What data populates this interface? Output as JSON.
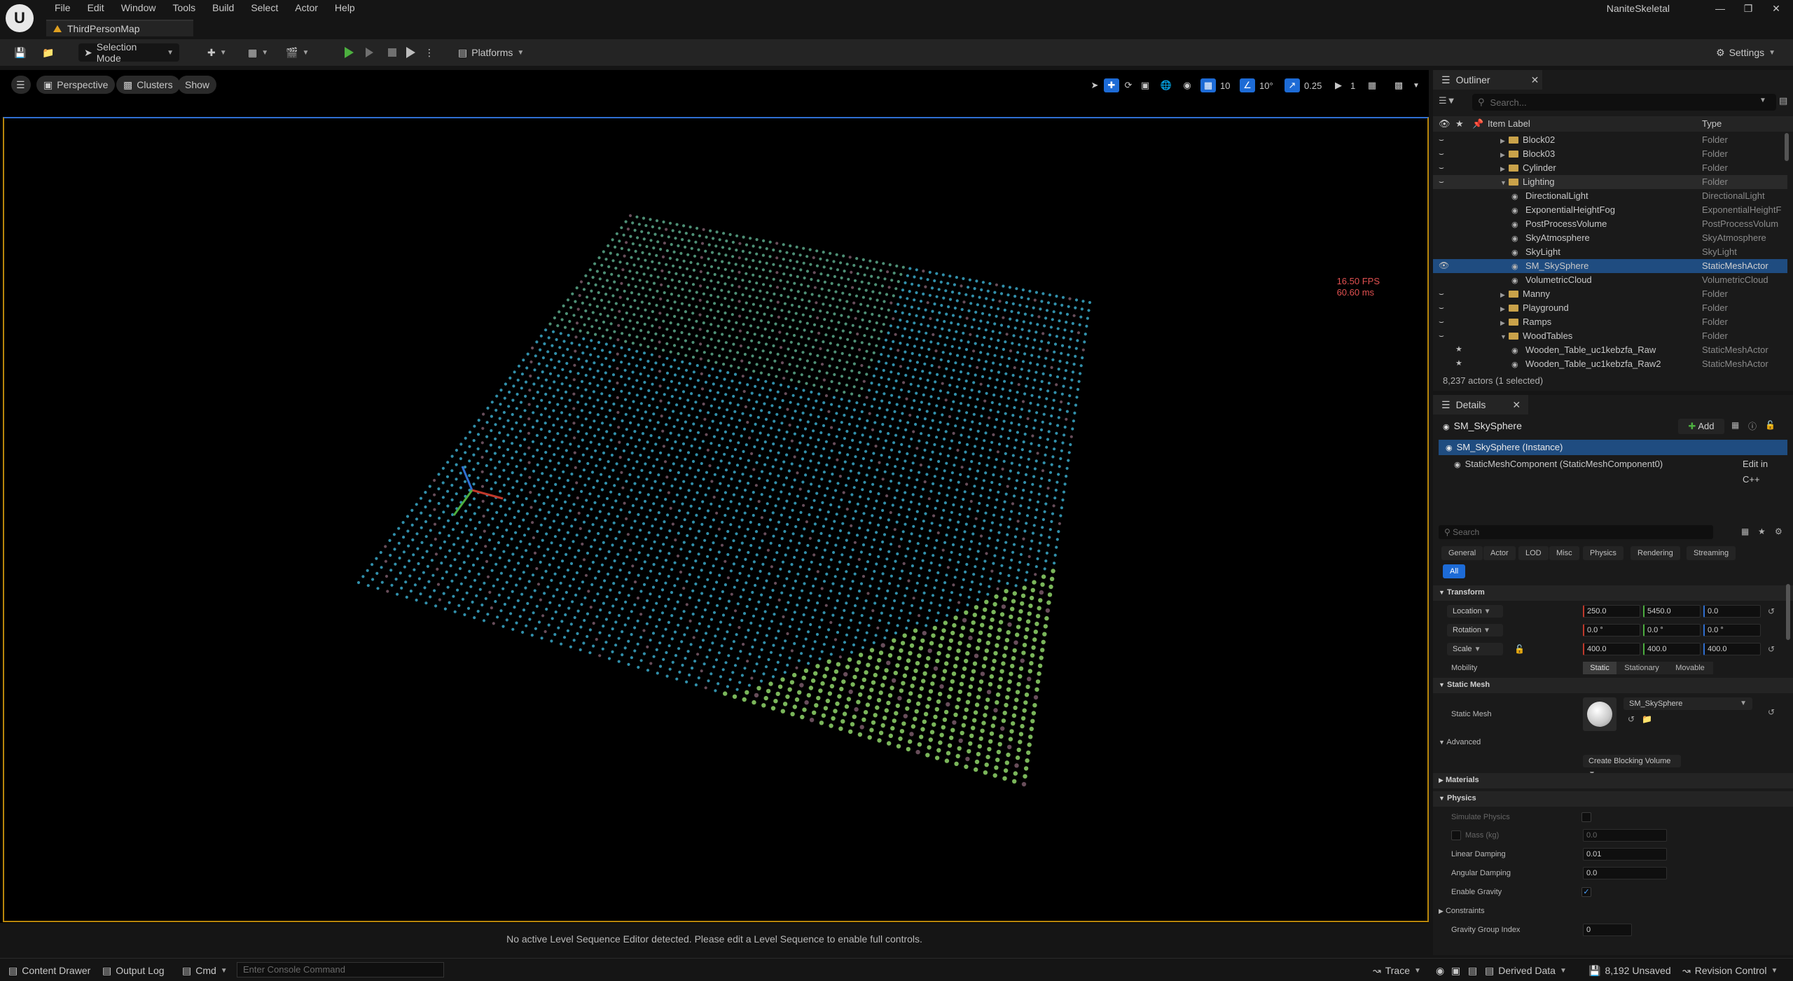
{
  "app": {
    "menu": [
      "File",
      "Edit",
      "Window",
      "Tools",
      "Build",
      "Select",
      "Actor",
      "Help"
    ],
    "map_tab": "ThirdPersonMap",
    "project_name": "NaniteSkeletal",
    "logo_letter": "U"
  },
  "toolbar": {
    "selection_mode": "Selection Mode",
    "platforms": "Platforms",
    "settings": "Settings"
  },
  "viewport": {
    "view_mode": "Perspective",
    "show_flag": "Clusters",
    "show": "Show",
    "grid_size": "10",
    "rotation_snap": "10°",
    "scale_snap": "0.25",
    "camera_speed": "1",
    "fps": "16.50 FPS",
    "frame_ms": "60.60 ms",
    "sequencer_message": "No active Level Sequence Editor detected. Please edit a Level Sequence to enable full controls."
  },
  "outliner": {
    "tab": "Outliner",
    "search_placeholder": "Search...",
    "col_label": "Item Label",
    "col_type": "Type",
    "rows": [
      {
        "label": "Block02",
        "type": "Folder",
        "kind": "folder",
        "indent": 1
      },
      {
        "label": "Block03",
        "type": "Folder",
        "kind": "folder",
        "indent": 1
      },
      {
        "label": "Cylinder",
        "type": "Folder",
        "kind": "folder",
        "indent": 1
      },
      {
        "label": "Lighting",
        "type": "Folder",
        "kind": "folder-open",
        "indent": 1
      },
      {
        "label": "DirectionalLight",
        "type": "DirectionalLight",
        "kind": "actor",
        "indent": 2
      },
      {
        "label": "ExponentialHeightFog",
        "type": "ExponentialHeightF",
        "kind": "actor",
        "indent": 2
      },
      {
        "label": "PostProcessVolume",
        "type": "PostProcessVolum",
        "kind": "actor",
        "indent": 2
      },
      {
        "label": "SkyAtmosphere",
        "type": "SkyAtmosphere",
        "kind": "actor",
        "indent": 2
      },
      {
        "label": "SkyLight",
        "type": "SkyLight",
        "kind": "actor",
        "indent": 2
      },
      {
        "label": "SM_SkySphere",
        "type": "StaticMeshActor",
        "kind": "actor",
        "indent": 2
      },
      {
        "label": "VolumetricCloud",
        "type": "VolumetricCloud",
        "kind": "actor",
        "indent": 2
      },
      {
        "label": "Manny",
        "type": "Folder",
        "kind": "folder",
        "indent": 1
      },
      {
        "label": "Playground",
        "type": "Folder",
        "kind": "folder",
        "indent": 1
      },
      {
        "label": "Ramps",
        "type": "Folder",
        "kind": "folder",
        "indent": 1
      },
      {
        "label": "WoodTables",
        "type": "Folder",
        "kind": "folder-open",
        "indent": 1
      },
      {
        "label": "Wooden_Table_uc1kebzfa_Raw",
        "type": "StaticMeshActor",
        "kind": "actor",
        "indent": 2
      },
      {
        "label": "Wooden_Table_uc1kebzfa_Raw2",
        "type": "StaticMeshActor",
        "kind": "actor",
        "indent": 2
      }
    ],
    "count": "8,237 actors (1 selected)"
  },
  "details": {
    "tab": "Details",
    "actor_name": "SM_SkySphere",
    "add": "Add",
    "instance": "SM_SkySphere (Instance)",
    "component": "StaticMeshComponent (StaticMeshComponent0)",
    "edit_cpp": "Edit in C++",
    "search_placeholder": "Search",
    "categories": [
      "General",
      "Actor",
      "LOD",
      "Misc",
      "Physics",
      "Rendering",
      "Streaming"
    ],
    "all": "All",
    "transform": {
      "title": "Transform",
      "location_label": "Location",
      "location": [
        "250.0",
        "5450.0",
        "0.0"
      ],
      "rotation_label": "Rotation",
      "rotation": [
        "0.0 °",
        "0.0 °",
        "0.0 °"
      ],
      "scale_label": "Scale",
      "scale": [
        "400.0",
        "400.0",
        "400.0"
      ],
      "mobility_label": "Mobility",
      "mobility_options": [
        "Static",
        "Stationary",
        "Movable"
      ]
    },
    "static_mesh": {
      "title": "Static Mesh",
      "label": "Static Mesh",
      "value": "SM_SkySphere"
    },
    "advanced": {
      "title": "Advanced",
      "blocking_volume": "Create Blocking Volume"
    },
    "materials": "Materials",
    "physics": {
      "title": "Physics",
      "simulate": "Simulate Physics",
      "mass": "Mass (kg)",
      "mass_value": "0.0",
      "linear_damping": "Linear Damping",
      "linear_damping_value": "0.01",
      "angular_damping": "Angular Damping",
      "angular_damping_value": "0.0",
      "enable_gravity": "Enable Gravity",
      "constraints": "Constraints",
      "gravity_group": "Gravity Group Index",
      "gravity_group_value": "0"
    }
  },
  "statusbar": {
    "content_drawer": "Content Drawer",
    "output_log": "Output Log",
    "cmd": "Cmd",
    "console_placeholder": "Enter Console Command",
    "trace": "Trace",
    "derived_data": "Derived Data",
    "unsaved": "8,192 Unsaved",
    "revision_control": "Revision Control"
  },
  "colors": {
    "accent": "#1d6bd6",
    "selection": "#1f4c80",
    "viewport_border": "#b8860b",
    "fps": "#e05050"
  }
}
